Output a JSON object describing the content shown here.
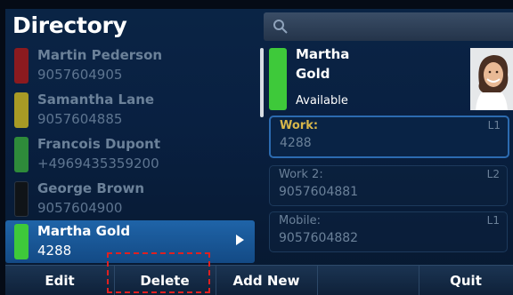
{
  "header": {
    "title": "Directory",
    "search_icon": "search-icon"
  },
  "contacts": [
    {
      "name": "Martin Pederson",
      "number": "9057604905",
      "status_color": "#8b1a1f"
    },
    {
      "name": "Samantha Lane",
      "number": "9057604885",
      "status_color": "#a89a25"
    },
    {
      "name": "Francois Dupont",
      "number": "+4969435359200",
      "status_color": "#2e8b3a"
    },
    {
      "name": "George Brown",
      "number": "9057604900",
      "status_color": "#101418"
    },
    {
      "name": "Martha Gold",
      "number": "4288",
      "status_color": "#3ec93a",
      "selected": true
    }
  ],
  "detail": {
    "first_name": "Martha",
    "last_name": "Gold",
    "status": "Available",
    "status_color": "#3ec93a",
    "fields": [
      {
        "label": "Work:",
        "value": "4288",
        "line": "L1",
        "active": true
      },
      {
        "label": "Work 2:",
        "value": "9057604881",
        "line": "L2"
      },
      {
        "label": "Mobile:",
        "value": "9057604882",
        "line": "L1"
      }
    ]
  },
  "softkeys": [
    {
      "label": "Edit"
    },
    {
      "label": "Delete",
      "highlighted": true
    },
    {
      "label": "Add New"
    },
    {
      "label": ""
    },
    {
      "label": "Quit"
    }
  ],
  "colors": {
    "highlight_box": "#e02020",
    "selected_row": "#1f64a8",
    "active_field_label": "#d7b64a"
  }
}
